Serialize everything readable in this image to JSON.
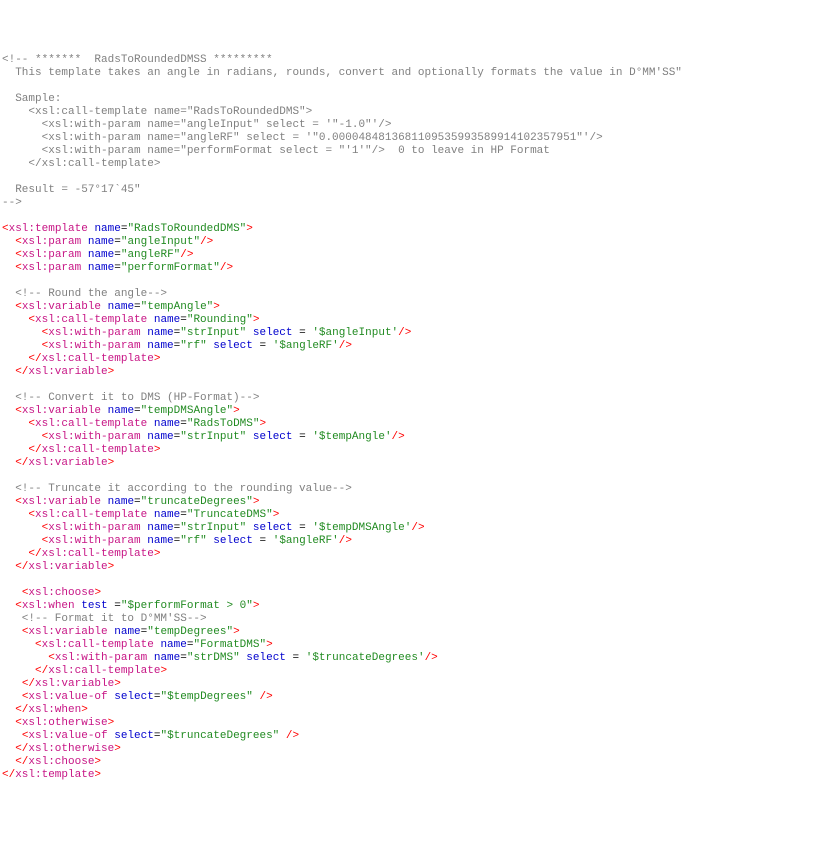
{
  "c1": "<!-- *******  RadsToRoundedDMSS *********",
  "c2": "  This template takes an angle in radians, rounds, convert and optionally formats the value in D°MM'SS\"",
  "c3": "",
  "c4": "  Sample:",
  "c5": "    <xsl:call-template name=\"RadsToRoundedDMS\">",
  "c6": "      <xsl:with-param name=\"angleInput\" select = '\"-1.0\"'/>",
  "c7": "      <xsl:with-param name=\"angleRF\" select = '\"0.0000484813681109535993589914102357951\"'/>",
  "c8": "      <xsl:with-param name=\"performFormat select = \"'1'\"/>  0 to leave in HP Format",
  "c9": "    </xsl:call-template>",
  "c10": "",
  "c11": "  Result = -57°17`45\"",
  "c12": "-->",
  "e1_open": "xsl:template",
  "e1_attr": "name",
  "e1_val": "\"RadsToRoundedDMS\"",
  "e2_open": "xsl:param",
  "e2_attr": "name",
  "e2_val": "\"angleInput\"",
  "e3_open": "xsl:param",
  "e3_attr": "name",
  "e3_val": "\"angleRF\"",
  "e4_open": "xsl:param",
  "e4_attr": "name",
  "e4_val": "\"performFormat\"",
  "c20": "  <!-- Round the angle-->",
  "v1": "xsl:variable",
  "v1a": "name",
  "v1v": "\"tempAngle\"",
  "ct1": "xsl:call-template",
  "ct1a": "name",
  "ct1v": "\"Rounding\"",
  "wp1": "xsl:with-param",
  "wp1a": "name",
  "wp1v": "\"strInput\"",
  "wp1b": "select",
  "wp1bv": "'$angleInput'",
  "wp2": "xsl:with-param",
  "wp2a": "name",
  "wp2v": "\"rf\"",
  "wp2b": "select",
  "wp2bv": "'$angleRF'",
  "ctc1": "xsl:call-template",
  "vc1": "xsl:variable",
  "c21": "  <!-- Convert it to DMS (HP-Format)-->",
  "v2": "xsl:variable",
  "v2a": "name",
  "v2v": "\"tempDMSAngle\"",
  "ct2": "xsl:call-template",
  "ct2a": "name",
  "ct2v": "\"RadsToDMS\"",
  "wp3": "xsl:with-param",
  "wp3a": "name",
  "wp3v": "\"strInput\"",
  "wp3b": "select",
  "wp3bv": "'$tempAngle'",
  "ctc2": "xsl:call-template",
  "vc2": "xsl:variable",
  "c22": "  <!-- Truncate it according to the rounding value-->",
  "v3": "xsl:variable",
  "v3a": "name",
  "v3v": "\"truncateDegrees\"",
  "ct3": "xsl:call-template",
  "ct3a": "name",
  "ct3v": "\"TruncateDMS\"",
  "wp4": "xsl:with-param",
  "wp4a": "name",
  "wp4v": "\"strInput\"",
  "wp4b": "select",
  "wp4bv": "'$tempDMSAngle'",
  "wp5": "xsl:with-param",
  "wp5a": "name",
  "wp5v": "\"rf\"",
  "wp5b": "select",
  "wp5bv": "'$angleRF'",
  "ctc3": "xsl:call-template",
  "vc3": "xsl:variable",
  "ch": "xsl:choose",
  "wh": "xsl:when",
  "wha": "test",
  "whv": "\"$performFormat > 0\"",
  "c23": "   <!-- Format it to D°MM'SS-->",
  "v4": "xsl:variable",
  "v4a": "name",
  "v4v": "\"tempDegrees\"",
  "ct4": "xsl:call-template",
  "ct4a": "name",
  "ct4v": "\"FormatDMS\"",
  "wp6": "xsl:with-param",
  "wp6a": "name",
  "wp6v": "\"strDMS\"",
  "wp6b": "select",
  "wp6bv": "'$truncateDegrees'",
  "ctc4": "xsl:call-template",
  "vc4": "xsl:variable",
  "vo1": "xsl:value-of",
  "vo1a": "select",
  "vo1v": "\"$tempDegrees\"",
  "whc": "xsl:when",
  "ot": "xsl:otherwise",
  "vo2": "xsl:value-of",
  "vo2a": "select",
  "vo2v": "\"$truncateDegrees\"",
  "otc": "xsl:otherwise",
  "chc": "xsl:choose",
  "tplc": "xsl:template"
}
